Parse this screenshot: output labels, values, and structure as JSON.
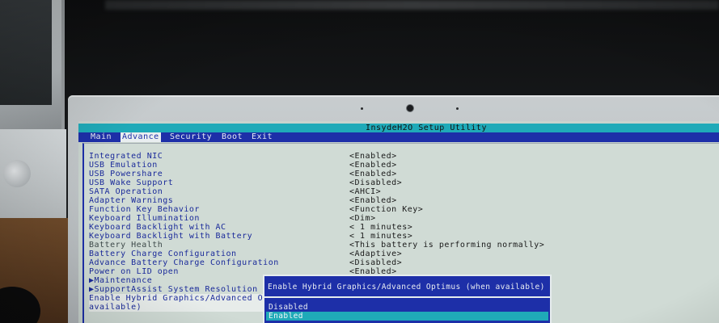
{
  "title": "InsydeH2O Setup Utility",
  "menu": [
    {
      "label": "Main",
      "active": false
    },
    {
      "label": "Advance",
      "active": true
    },
    {
      "label": "Security",
      "active": false
    },
    {
      "label": "Boot",
      "active": false
    },
    {
      "label": "Exit",
      "active": false
    }
  ],
  "settings": [
    {
      "label": "Integrated NIC",
      "value": "<Enabled>"
    },
    {
      "label": "USB Emulation",
      "value": "<Enabled>"
    },
    {
      "label": "USB Powershare",
      "value": "<Enabled>"
    },
    {
      "label": "USB Wake Support",
      "value": "<Disabled>"
    },
    {
      "label": "SATA Operation",
      "value": "<AHCI>"
    },
    {
      "label": "Adapter Warnings",
      "value": "<Enabled>"
    },
    {
      "label": "Function Key Behavior",
      "value": "<Function Key>"
    },
    {
      "label": "Keyboard Illumination",
      "value": "<Dim>"
    },
    {
      "label": "Keyboard Backlight with AC",
      "value": "< 1 minutes>"
    },
    {
      "label": "Keyboard Backlight with Battery",
      "value": "< 1 minutes>"
    },
    {
      "label": "Battery Health",
      "value": "<This battery is performing normally>"
    },
    {
      "label": "Battery Charge Configuration",
      "value": "<Adaptive>"
    },
    {
      "label": "Advance Battery Charge Configuration",
      "value": "<Disabled>"
    },
    {
      "label": "Power on LID open",
      "value": "<Enabled>"
    },
    {
      "label": "▶Maintenance",
      "value": ""
    },
    {
      "label": "▶SupportAssist System Resolution",
      "value": ""
    },
    {
      "label": "Enable Hybrid Graphics/Advanced Op",
      "value": ""
    },
    {
      "label": "available)",
      "value": ""
    }
  ],
  "popup": {
    "title": "Enable Hybrid Graphics/Advanced Optimus (when available)",
    "options": [
      {
        "label": "Disabled",
        "selected": false
      },
      {
        "label": "Enabled",
        "selected": true
      }
    ]
  },
  "colors": {
    "title_bar": "#1faab8",
    "menu_bar": "#1d2fa8",
    "screen_bg": "#d0dbd5",
    "label_text": "#1a2a9a",
    "popup_bg": "#1d2fa8",
    "selected_option": "#1faab8"
  }
}
